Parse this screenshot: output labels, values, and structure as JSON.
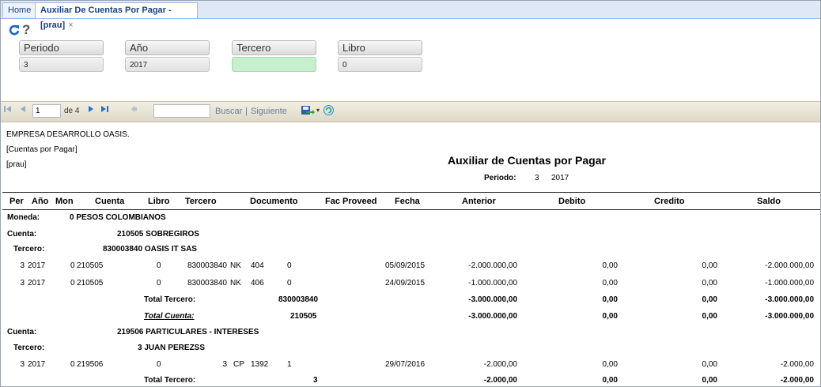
{
  "tabs": [
    {
      "label": "Home"
    },
    {
      "label": "Auxiliar De Cuentas Por Pagar -[prau]",
      "close": "×"
    }
  ],
  "form": {
    "icons": {
      "refresh": "C",
      "help": "?"
    },
    "fields": [
      {
        "label": "Periodo",
        "value": "3"
      },
      {
        "label": "Año",
        "value": "2017"
      },
      {
        "label": "Tercero",
        "value": ""
      },
      {
        "label": "Libro",
        "value": "0"
      }
    ]
  },
  "toolbar": {
    "page": "1",
    "of_pages": "de 4",
    "search_value": "",
    "search_label": "Buscar",
    "separator": "|",
    "next_label": "Siguiente"
  },
  "report": {
    "company": "EMPRESA DESARROLLO OASIS.",
    "subtitle": "[Cuentas por Pagar]",
    "user": "[prau]",
    "title": "Auxiliar de Cuentas por Pagar",
    "periodo_label": "Periodo:",
    "periodo_value": "3",
    "periodo_year": "2017",
    "columns": [
      "Per",
      "Año",
      "Mon",
      "Cuenta",
      "Libro",
      "Tercero",
      "Documento",
      "Fac Proveed",
      "Fecha",
      "Anterior",
      "Debito",
      "Credito",
      "Saldo"
    ],
    "moneda_label": "Moneda:",
    "moneda_value": "0 PESOS COLOMBIANOS",
    "cuenta_label": "Cuenta:",
    "tercero_label": "Tercero:",
    "total_tercero_label": "Total Tercero:",
    "total_cuenta_label": "Total Cuenta:",
    "cuenta1": "210505 SOBREGIROS",
    "tercero1": "830003840 OASIS IT SAS",
    "rows1": [
      {
        "per": "3",
        "anio": "2017",
        "mon": "0",
        "cuenta": "210505",
        "libro": "0",
        "tercero": "830003840",
        "tipo": "NK",
        "doc": "404",
        "docn": "0",
        "fecha": "05/09/2015",
        "anterior": "-2.000.000,00",
        "debito": "0,00",
        "credito": "0,00",
        "saldo": "-2.000.000,00"
      },
      {
        "per": "3",
        "anio": "2017",
        "mon": "0",
        "cuenta": "210505",
        "libro": "0",
        "tercero": "830003840",
        "tipo": "NK",
        "doc": "406",
        "docn": "0",
        "fecha": "24/09/2015",
        "anterior": "-1.000.000,00",
        "debito": "0,00",
        "credito": "0,00",
        "saldo": "-1.000.000,00"
      }
    ],
    "total_tercero1": {
      "code": "830003840",
      "anterior": "-3.000.000,00",
      "debito": "0,00",
      "credito": "0,00",
      "saldo": "-3.000.000,00"
    },
    "total_cuenta1": {
      "code": "210505",
      "anterior": "-3.000.000,00",
      "debito": "0,00",
      "credito": "0,00",
      "saldo": "-3.000.000,00"
    },
    "cuenta2": "219506 PARTICULARES - INTERESES",
    "tercero2": "3 JUAN PEREZSS",
    "rows2": [
      {
        "per": "3",
        "anio": "2017",
        "mon": "0",
        "cuenta": "219506",
        "libro": "0",
        "tercero": "3",
        "tipo": "CP",
        "doc": "1392",
        "docn": "1",
        "fecha": "29/07/2016",
        "anterior": "-2.000,00",
        "debito": "0,00",
        "credito": "0,00",
        "saldo": "-2.000,00"
      }
    ],
    "total_tercero2": {
      "code": "3",
      "anterior": "-2.000,00",
      "debito": "0,00",
      "credito": "0,00",
      "saldo": "-2.000,00"
    }
  }
}
